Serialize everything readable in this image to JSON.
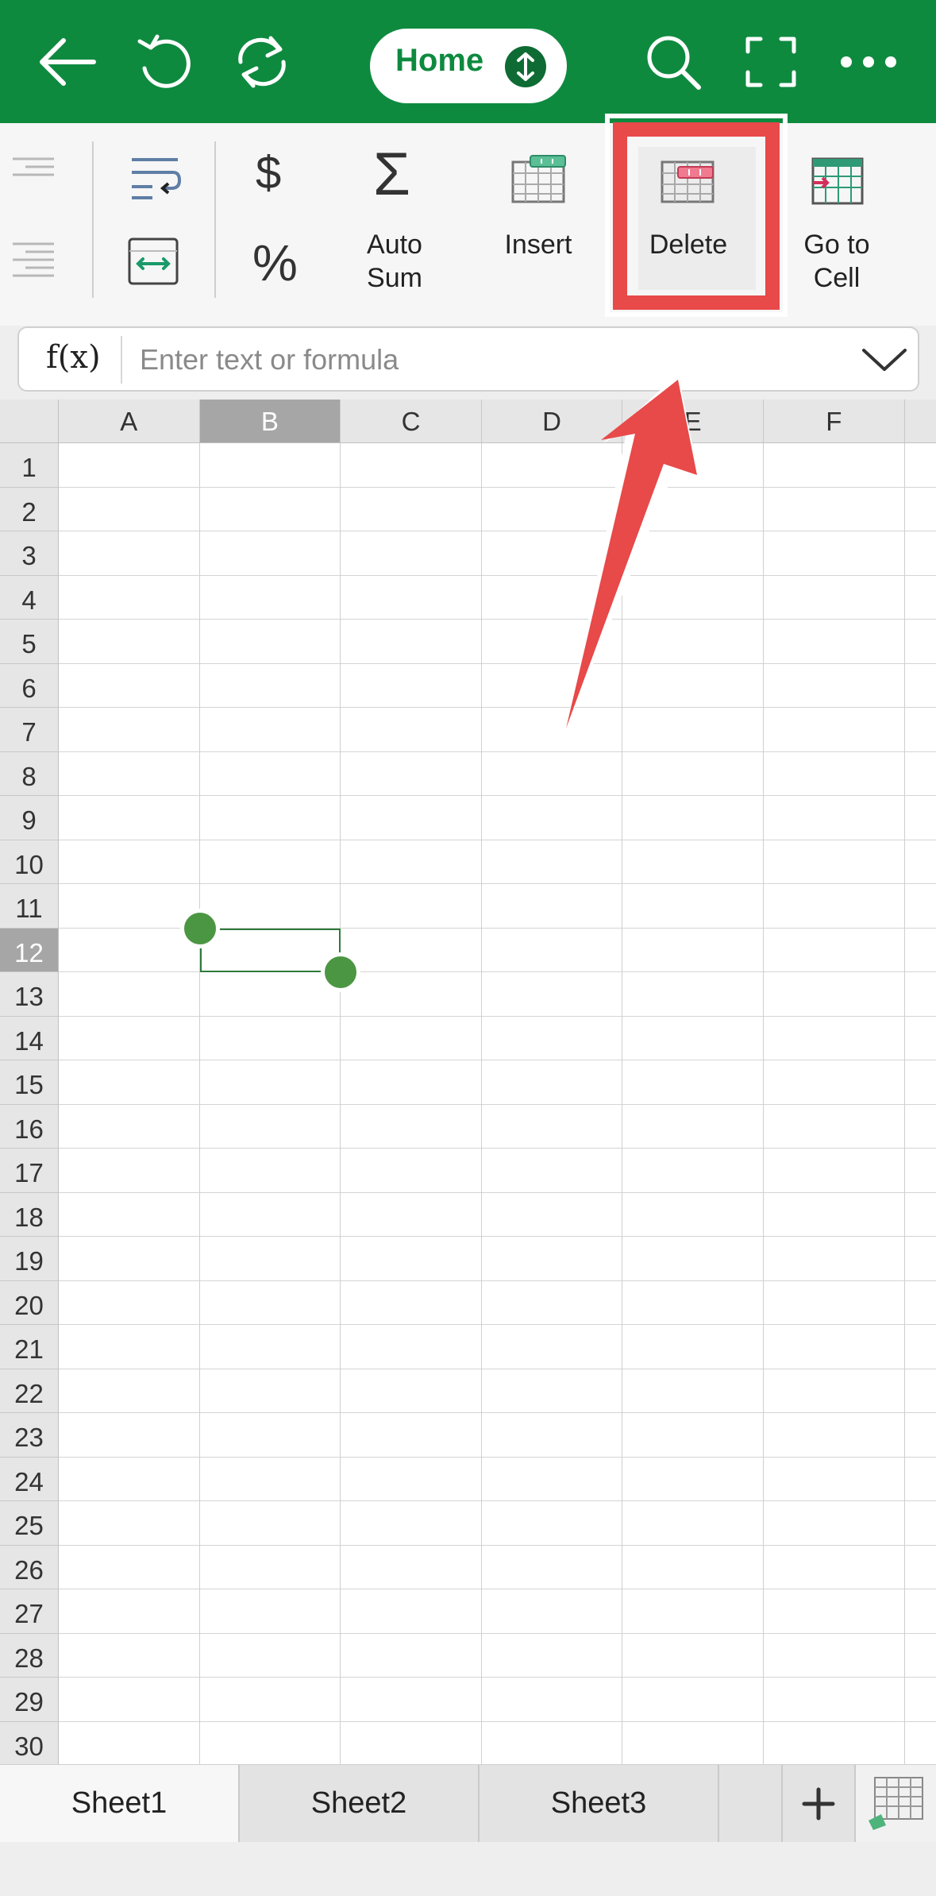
{
  "topbar": {
    "home_label": "Home"
  },
  "ribbon": {
    "autosum_label_line1": "Auto",
    "autosum_label_line2": "Sum",
    "insert_label": "Insert",
    "delete_label": "Delete",
    "goto_label_line1": "Go to",
    "goto_label_line2": "Cell",
    "currency_glyph": "$",
    "percent_glyph": "%",
    "sigma_glyph": "Σ"
  },
  "formula_bar": {
    "fx_label": "f(x)",
    "placeholder": "Enter text or formula"
  },
  "grid": {
    "columns": [
      "A",
      "B",
      "C",
      "D",
      "E",
      "F"
    ],
    "selected_column": "B",
    "rows": [
      "1",
      "2",
      "3",
      "4",
      "5",
      "6",
      "7",
      "8",
      "9",
      "10",
      "11",
      "12",
      "13",
      "14",
      "15",
      "16",
      "17",
      "18",
      "19",
      "20",
      "21",
      "22",
      "23",
      "24",
      "25",
      "26",
      "27",
      "28",
      "29",
      "30"
    ],
    "selected_row": "12"
  },
  "sheets": {
    "tabs": [
      "Sheet1",
      "Sheet2",
      "Sheet3"
    ],
    "active": "Sheet1"
  },
  "colors": {
    "brand_green": "#0e8a3f",
    "highlight_red": "#e84949",
    "selection_green": "#4b9643"
  }
}
